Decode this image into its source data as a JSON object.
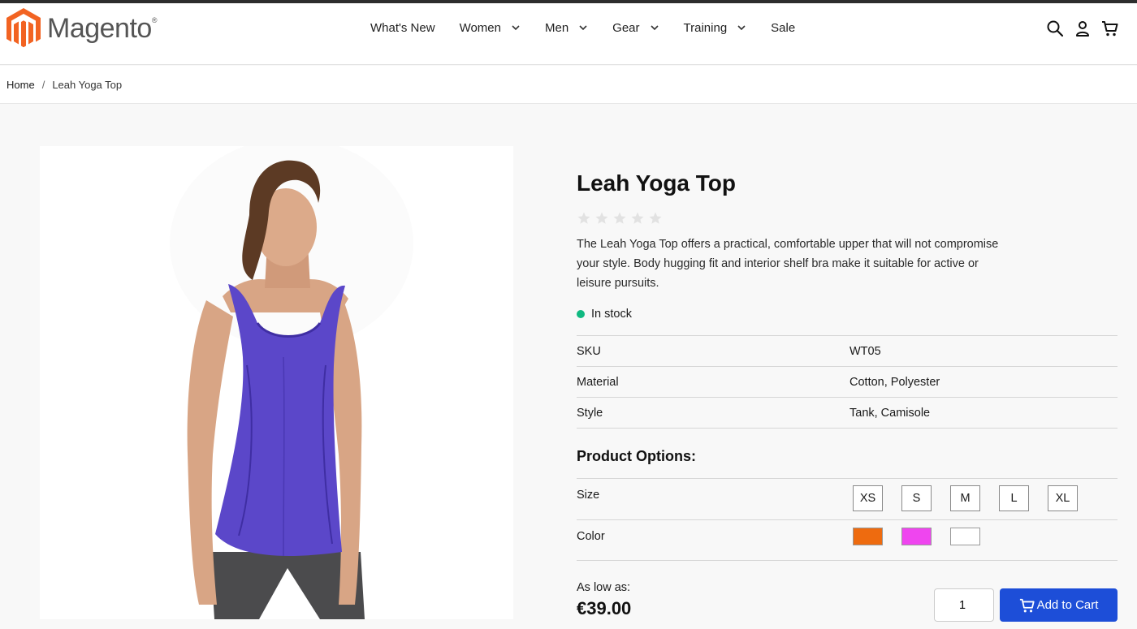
{
  "brand": {
    "name": "Magento",
    "mark": "®"
  },
  "nav": [
    {
      "label": "What's New",
      "dropdown": false
    },
    {
      "label": "Women",
      "dropdown": true
    },
    {
      "label": "Men",
      "dropdown": true
    },
    {
      "label": "Gear",
      "dropdown": true
    },
    {
      "label": "Training",
      "dropdown": true
    },
    {
      "label": "Sale",
      "dropdown": false
    }
  ],
  "header_icons": [
    "search-icon",
    "account-icon",
    "cart-icon"
  ],
  "breadcrumb": {
    "home": "Home",
    "separator": "/",
    "current": "Leah Yoga Top"
  },
  "product": {
    "title": "Leah Yoga Top",
    "rating_stars": 5,
    "rating_value": 0,
    "description": "The Leah Yoga Top offers a practical, comfortable upper that will not compromise your style. Body hugging fit and interior shelf bra make it suitable for active or leisure pursuits.",
    "stock": "In stock",
    "attributes": [
      {
        "key": "SKU",
        "value": "WT05"
      },
      {
        "key": "Material",
        "value": "Cotton, Polyester"
      },
      {
        "key": "Style",
        "value": "Tank, Camisole"
      }
    ],
    "options_title": "Product Options:",
    "size_label": "Size",
    "sizes": [
      "XS",
      "S",
      "M",
      "L",
      "XL"
    ],
    "color_label": "Color",
    "colors": [
      "#ee6b0f",
      "#ef45ef",
      "#ffffff"
    ],
    "price_label": "As low as:",
    "price": "€39.00",
    "quantity": "1",
    "add_to_cart": "Add to Cart"
  },
  "colors": {
    "accent": "#1d4ed8",
    "stock": "#10b981",
    "logo": "#f26322"
  }
}
